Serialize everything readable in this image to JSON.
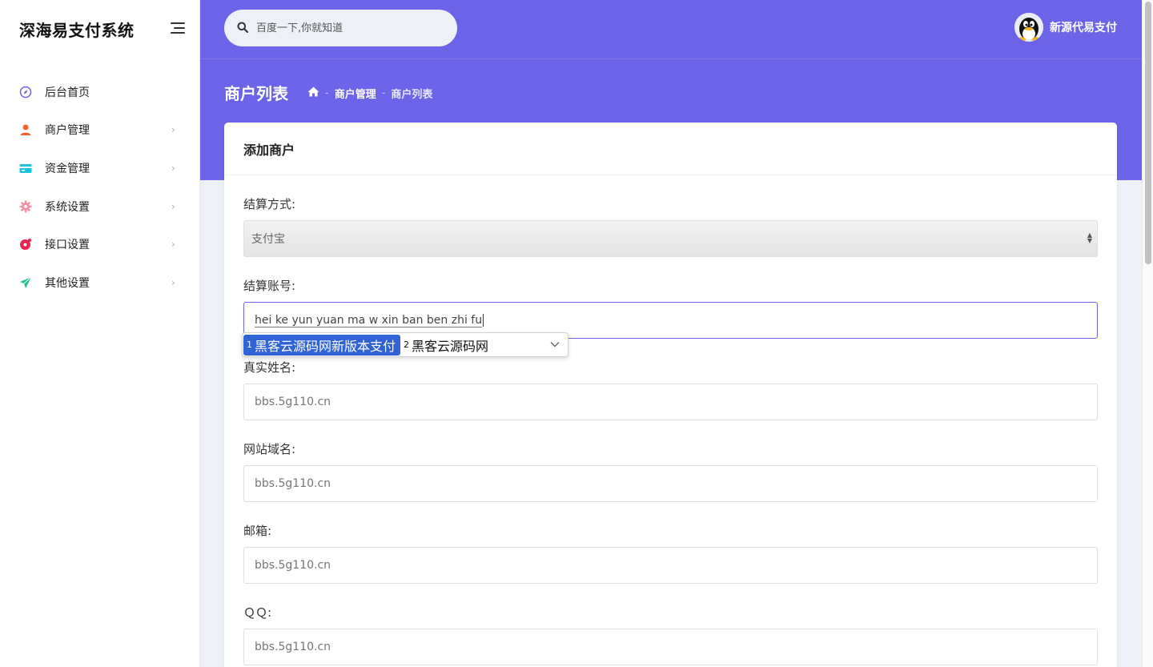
{
  "sidebar": {
    "brand": "深海易支付系统",
    "items": [
      {
        "label": "后台首页",
        "icon": "compass-icon",
        "color": "#6b63e8",
        "has_children": false
      },
      {
        "label": "商户管理",
        "icon": "user-icon",
        "color": "#f5622d",
        "has_children": true
      },
      {
        "label": "资金管理",
        "icon": "card-icon",
        "color": "#17c6dd",
        "has_children": true
      },
      {
        "label": "系统设置",
        "icon": "gear-icon",
        "color": "#f78ca0",
        "has_children": true
      },
      {
        "label": "接口设置",
        "icon": "api-icon",
        "color": "#e8244e",
        "has_children": true
      },
      {
        "label": "其他设置",
        "icon": "send-icon",
        "color": "#19c28a",
        "has_children": true
      }
    ]
  },
  "header": {
    "search_placeholder": "百度一下,你就知道",
    "username": "新源代易支付"
  },
  "page": {
    "title": "商户列表",
    "breadcrumb": [
      "商户管理",
      "商户列表"
    ]
  },
  "card": {
    "title": "添加商户",
    "fields": [
      {
        "label": "结算方式:",
        "type": "select",
        "value": "支付宝"
      },
      {
        "label": "结算账号:",
        "type": "text",
        "value": "hei ke yun yuan ma w xin ban ben zhi fu",
        "focused": true
      },
      {
        "label": "真实姓名:",
        "type": "text",
        "placeholder": "bbs.5g110.cn"
      },
      {
        "label": "网站域名:",
        "type": "text",
        "placeholder": "bbs.5g110.cn"
      },
      {
        "label": "邮箱:",
        "type": "text",
        "placeholder": "bbs.5g110.cn"
      },
      {
        "label": "ＱＱ:",
        "type": "text",
        "placeholder": "bbs.5g110.cn"
      }
    ]
  },
  "ime": {
    "candidates": [
      {
        "num": "1",
        "text": "黑客云源码网新版本支付",
        "selected": true
      },
      {
        "num": "2",
        "text": "黑客云源码网",
        "selected": false
      }
    ]
  },
  "colors": {
    "accent": "#6b63e8",
    "ime_selected": "#2f63d6"
  }
}
